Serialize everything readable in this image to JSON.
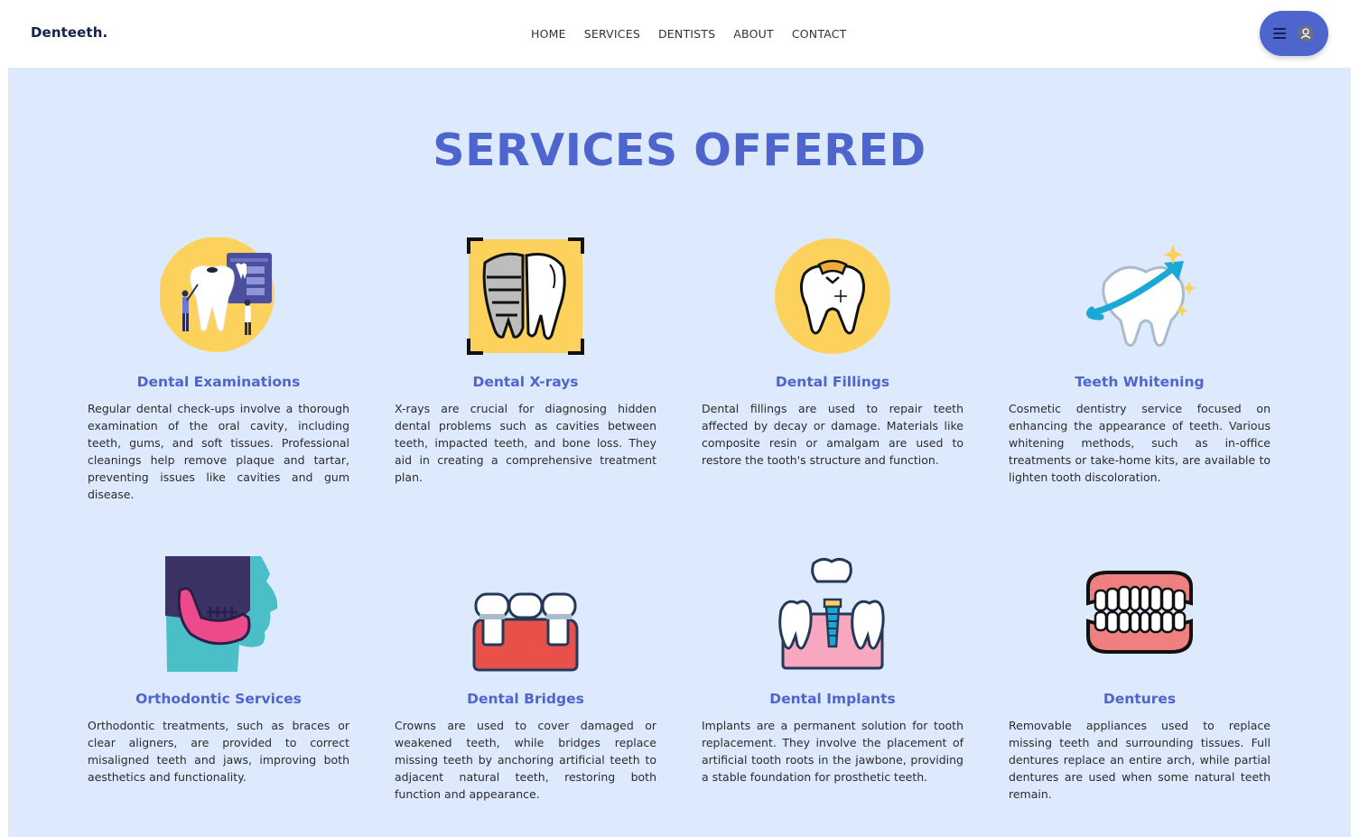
{
  "brand": {
    "logo": "Denteeth."
  },
  "nav": {
    "links": [
      "HOME",
      "SERVICES",
      "DENTISTS",
      "ABOUT",
      "CONTACT"
    ]
  },
  "header_menu": {
    "icons": [
      "hamburger-icon",
      "user-avatar-icon"
    ],
    "accent": "#4d65cc"
  },
  "page": {
    "title": "SERVICES OFFERED",
    "background": "#ddeafd",
    "services": [
      {
        "icon": "tooth-examination-icon",
        "title": "Dental Examinations",
        "description": "Regular dental check-ups involve a thorough examination of the oral cavity, including teeth, gums, and soft tissues. Professional cleanings help remove plaque and tartar, preventing issues like cavities and gum disease."
      },
      {
        "icon": "tooth-xray-icon",
        "title": "Dental X-rays",
        "description": "X-rays are crucial for diagnosing hidden dental problems such as cavities between teeth, impacted teeth, and bone loss. They aid in creating a comprehensive treatment plan."
      },
      {
        "icon": "tooth-filling-icon",
        "title": "Dental Fillings",
        "description": "Dental fillings are used to repair teeth affected by decay or damage. Materials like composite resin or amalgam are used to restore the tooth's structure and function."
      },
      {
        "icon": "tooth-whitening-icon",
        "title": "Teeth Whitening",
        "description": "Cosmetic dentistry service focused on enhancing the appearance of teeth. Various whitening methods, such as in-office treatments or take-home kits, are available to lighten tooth discoloration."
      },
      {
        "icon": "jaw-profile-icon",
        "title": "Orthodontic Services",
        "description": "Orthodontic treatments, such as braces or clear aligners, are provided to correct misaligned teeth and jaws, improving both aesthetics and functionality."
      },
      {
        "icon": "dental-bridge-icon",
        "title": "Dental Bridges",
        "description": "Crowns are used to cover damaged or weakened teeth, while bridges replace missing teeth by anchoring artificial teeth to adjacent natural teeth, restoring both function and appearance."
      },
      {
        "icon": "dental-implant-icon",
        "title": "Dental Implants",
        "description": "Implants are a permanent solution for tooth replacement. They involve the placement of artificial tooth roots in the jawbone, providing a stable foundation for prosthetic teeth."
      },
      {
        "icon": "dentures-icon",
        "title": "Dentures",
        "description": "Removable appliances used to replace missing teeth and surrounding tissues. Full dentures replace an entire arch, while partial dentures are used when some natural teeth remain."
      }
    ]
  }
}
